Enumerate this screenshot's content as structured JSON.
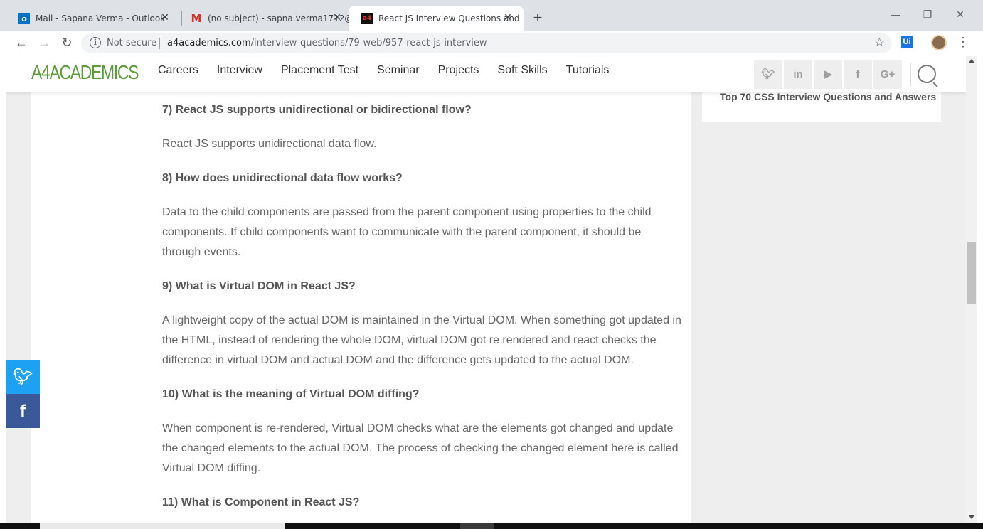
{
  "browser": {
    "tabs": [
      {
        "title": "Mail - Sapana Verma - Outlook",
        "icon": "outlook-icon"
      },
      {
        "title": "(no subject) - sapna.verma1712@",
        "icon": "gmail-icon"
      },
      {
        "title": "React JS Interview Questions and",
        "icon": "a4academics-favicon"
      }
    ],
    "new_tab": "+",
    "security_label": "Not secure",
    "url_domain": "a4academics.com",
    "url_path": "/interview-questions/79-web/957-react-js-interview",
    "extension_label": "Ui"
  },
  "site": {
    "logo": "A4ACADEMICS",
    "menu": [
      "Careers",
      "Interview",
      "Placement Test",
      "Seminar",
      "Projects",
      "Soft Skills",
      "Tutorials"
    ],
    "social": [
      {
        "name": "twitter",
        "glyph": "𝕪"
      },
      {
        "name": "linkedin",
        "glyph": "in"
      },
      {
        "name": "youtube",
        "glyph": "▶"
      },
      {
        "name": "facebook",
        "glyph": "f"
      },
      {
        "name": "google-plus",
        "glyph": "G+"
      }
    ],
    "colors": {
      "logo": "#5d9c3c",
      "twitter": "#1da1f2",
      "facebook": "#3b5998"
    }
  },
  "sidebar": {
    "related_link": "Top 70 CSS Interview Questions and Answers"
  },
  "article": {
    "items": [
      {
        "q": "7) React JS supports unidirectional or bidirectional flow?",
        "a": "React JS supports unidirectional data flow."
      },
      {
        "q": "8) How does unidirectional data flow works?",
        "a": "Data to the child components are passed from the parent component using properties to the child components. If child components want to communicate with the parent component, it should be through events."
      },
      {
        "q": "9) What is Virtual DOM in React JS?",
        "a": "A lightweight copy of the actual DOM is maintained in the Virtual DOM. When something got updated in the HTML, instead of rendering the whole DOM, virtual DOM got re rendered and react checks the difference in virtual DOM and actual DOM and the difference gets updated to the actual DOM."
      },
      {
        "q": "10) What is the meaning of Virtual DOM diffing?",
        "a": "When component is re-rendered, Virtual DOM checks what are the elements got changed and update the changed elements to the actual DOM. The process of checking the changed element here is called Virtual DOM diffing."
      },
      {
        "q": "11) What is Component in React JS?"
      }
    ]
  }
}
